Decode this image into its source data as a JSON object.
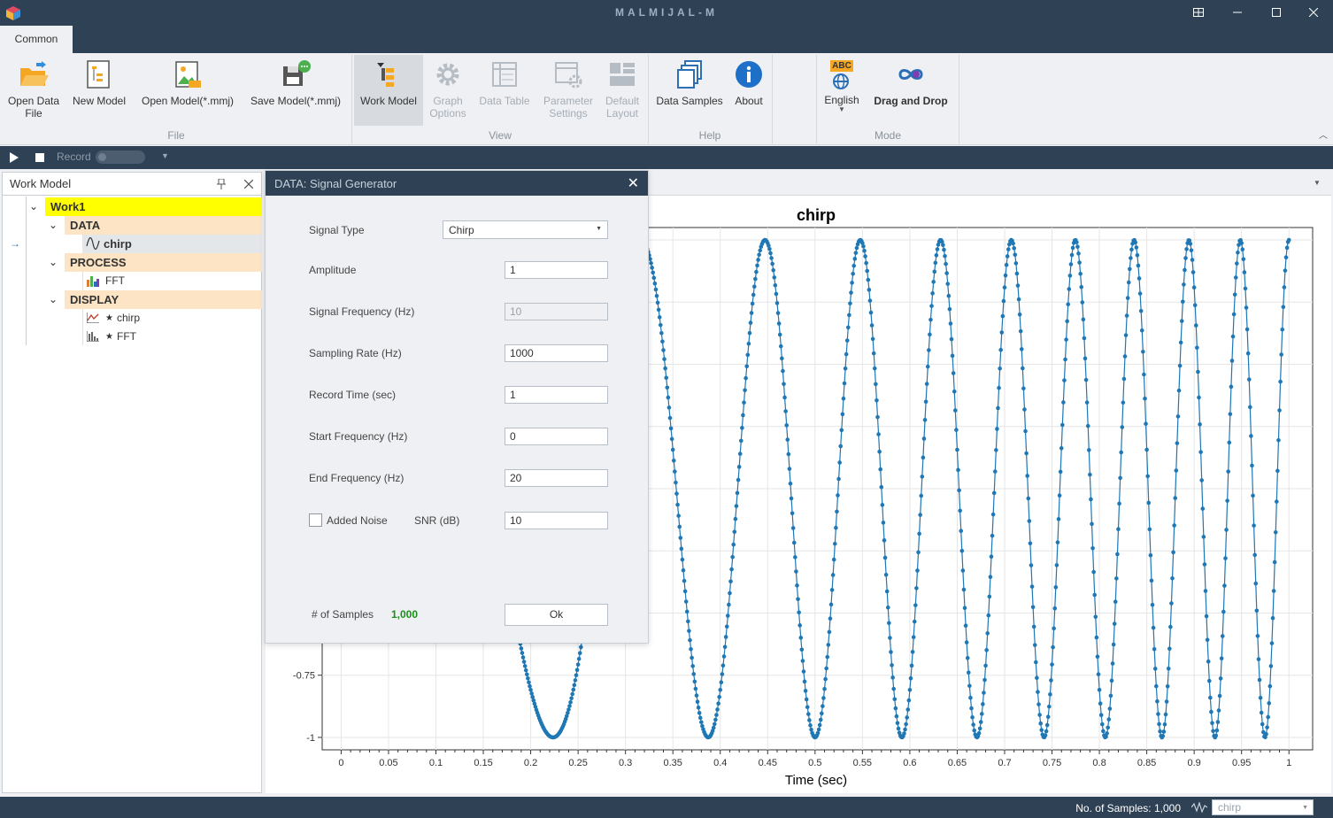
{
  "app": {
    "title": "MALMIJAL-M"
  },
  "ribbon": {
    "tab": "Common",
    "file": {
      "label": "File",
      "open_data_file": "Open Data\nFile",
      "new_model": "New Model",
      "open_model": "Open Model(*.mmj)",
      "save_model": "Save Model(*.mmj)"
    },
    "view": {
      "label": "View",
      "work_model": "Work Model",
      "graph_options": "Graph\nOptions",
      "data_table": "Data Table",
      "parameter_settings": "Parameter\nSettings",
      "default_layout": "Default\nLayout"
    },
    "help": {
      "label": "Help",
      "data_samples": "Data Samples",
      "about": "About"
    },
    "mode": {
      "label": "Mode",
      "language": "English",
      "drag_drop": "Drag and Drop",
      "abc": "ABC"
    }
  },
  "toolbar": {
    "record": "Record"
  },
  "work_model": {
    "title": "Work Model",
    "root": "Work1",
    "data": {
      "label": "DATA",
      "item": "chirp"
    },
    "process": {
      "label": "PROCESS",
      "item": "FFT"
    },
    "display": {
      "label": "DISPLAY",
      "items": [
        "chirp",
        "FFT"
      ]
    }
  },
  "dialog": {
    "title": "DATA: Signal Generator",
    "signal_type": {
      "label": "Signal Type",
      "value": "Chirp"
    },
    "amplitude": {
      "label": "Amplitude",
      "value": "1"
    },
    "signal_frequency": {
      "label": "Signal Frequency (Hz)",
      "value": "10"
    },
    "sampling_rate": {
      "label": "Sampling Rate (Hz)",
      "value": "1000"
    },
    "record_time": {
      "label": "Record Time (sec)",
      "value": "1"
    },
    "start_frequency": {
      "label": "Start Frequency (Hz)",
      "value": "0"
    },
    "end_frequency": {
      "label": "End Frequency (Hz)",
      "value": "20"
    },
    "added_noise": {
      "label": "Added Noise",
      "checked": false
    },
    "snr": {
      "label": "SNR (dB)",
      "value": "10"
    },
    "samples": {
      "label": "# of Samples",
      "value": "1,000"
    },
    "ok": "Ok"
  },
  "chart_data": {
    "type": "line",
    "title": "chirp",
    "xlabel": "Time (sec)",
    "ylabel": "",
    "xlim": [
      -0.02,
      1.025
    ],
    "ylim": [
      -1.05,
      1.05
    ],
    "x_ticks": [
      "0",
      "0.05",
      "0.1",
      "0.15",
      "0.2",
      "0.25",
      "0.3",
      "0.35",
      "0.4",
      "0.45",
      "0.5",
      "0.55",
      "0.6",
      "0.65",
      "0.7",
      "0.75",
      "0.8",
      "0.85",
      "0.9",
      "0.95",
      "1"
    ],
    "y_ticks": [
      "-0.75",
      "-1"
    ],
    "series": [
      {
        "color": "#1f77b4",
        "function": "cos(2*pi*(10*t^2))",
        "t_start": 0,
        "t_end": 1,
        "sample_step": 0.001,
        "start_frequency_hz": 0,
        "end_frequency_hz": 20
      }
    ],
    "grid": true,
    "markers": true
  },
  "status": {
    "samples_text": "No. of Samples: 1,000",
    "select_value": "chirp"
  },
  "colors": {
    "titlebar": "#2f4155",
    "ribbon": "#eef0f3",
    "tree_root": "#ffff00",
    "tree_group": "#fce4c4",
    "series": "#1f77b4",
    "samples_value": "#1a8f1a"
  }
}
